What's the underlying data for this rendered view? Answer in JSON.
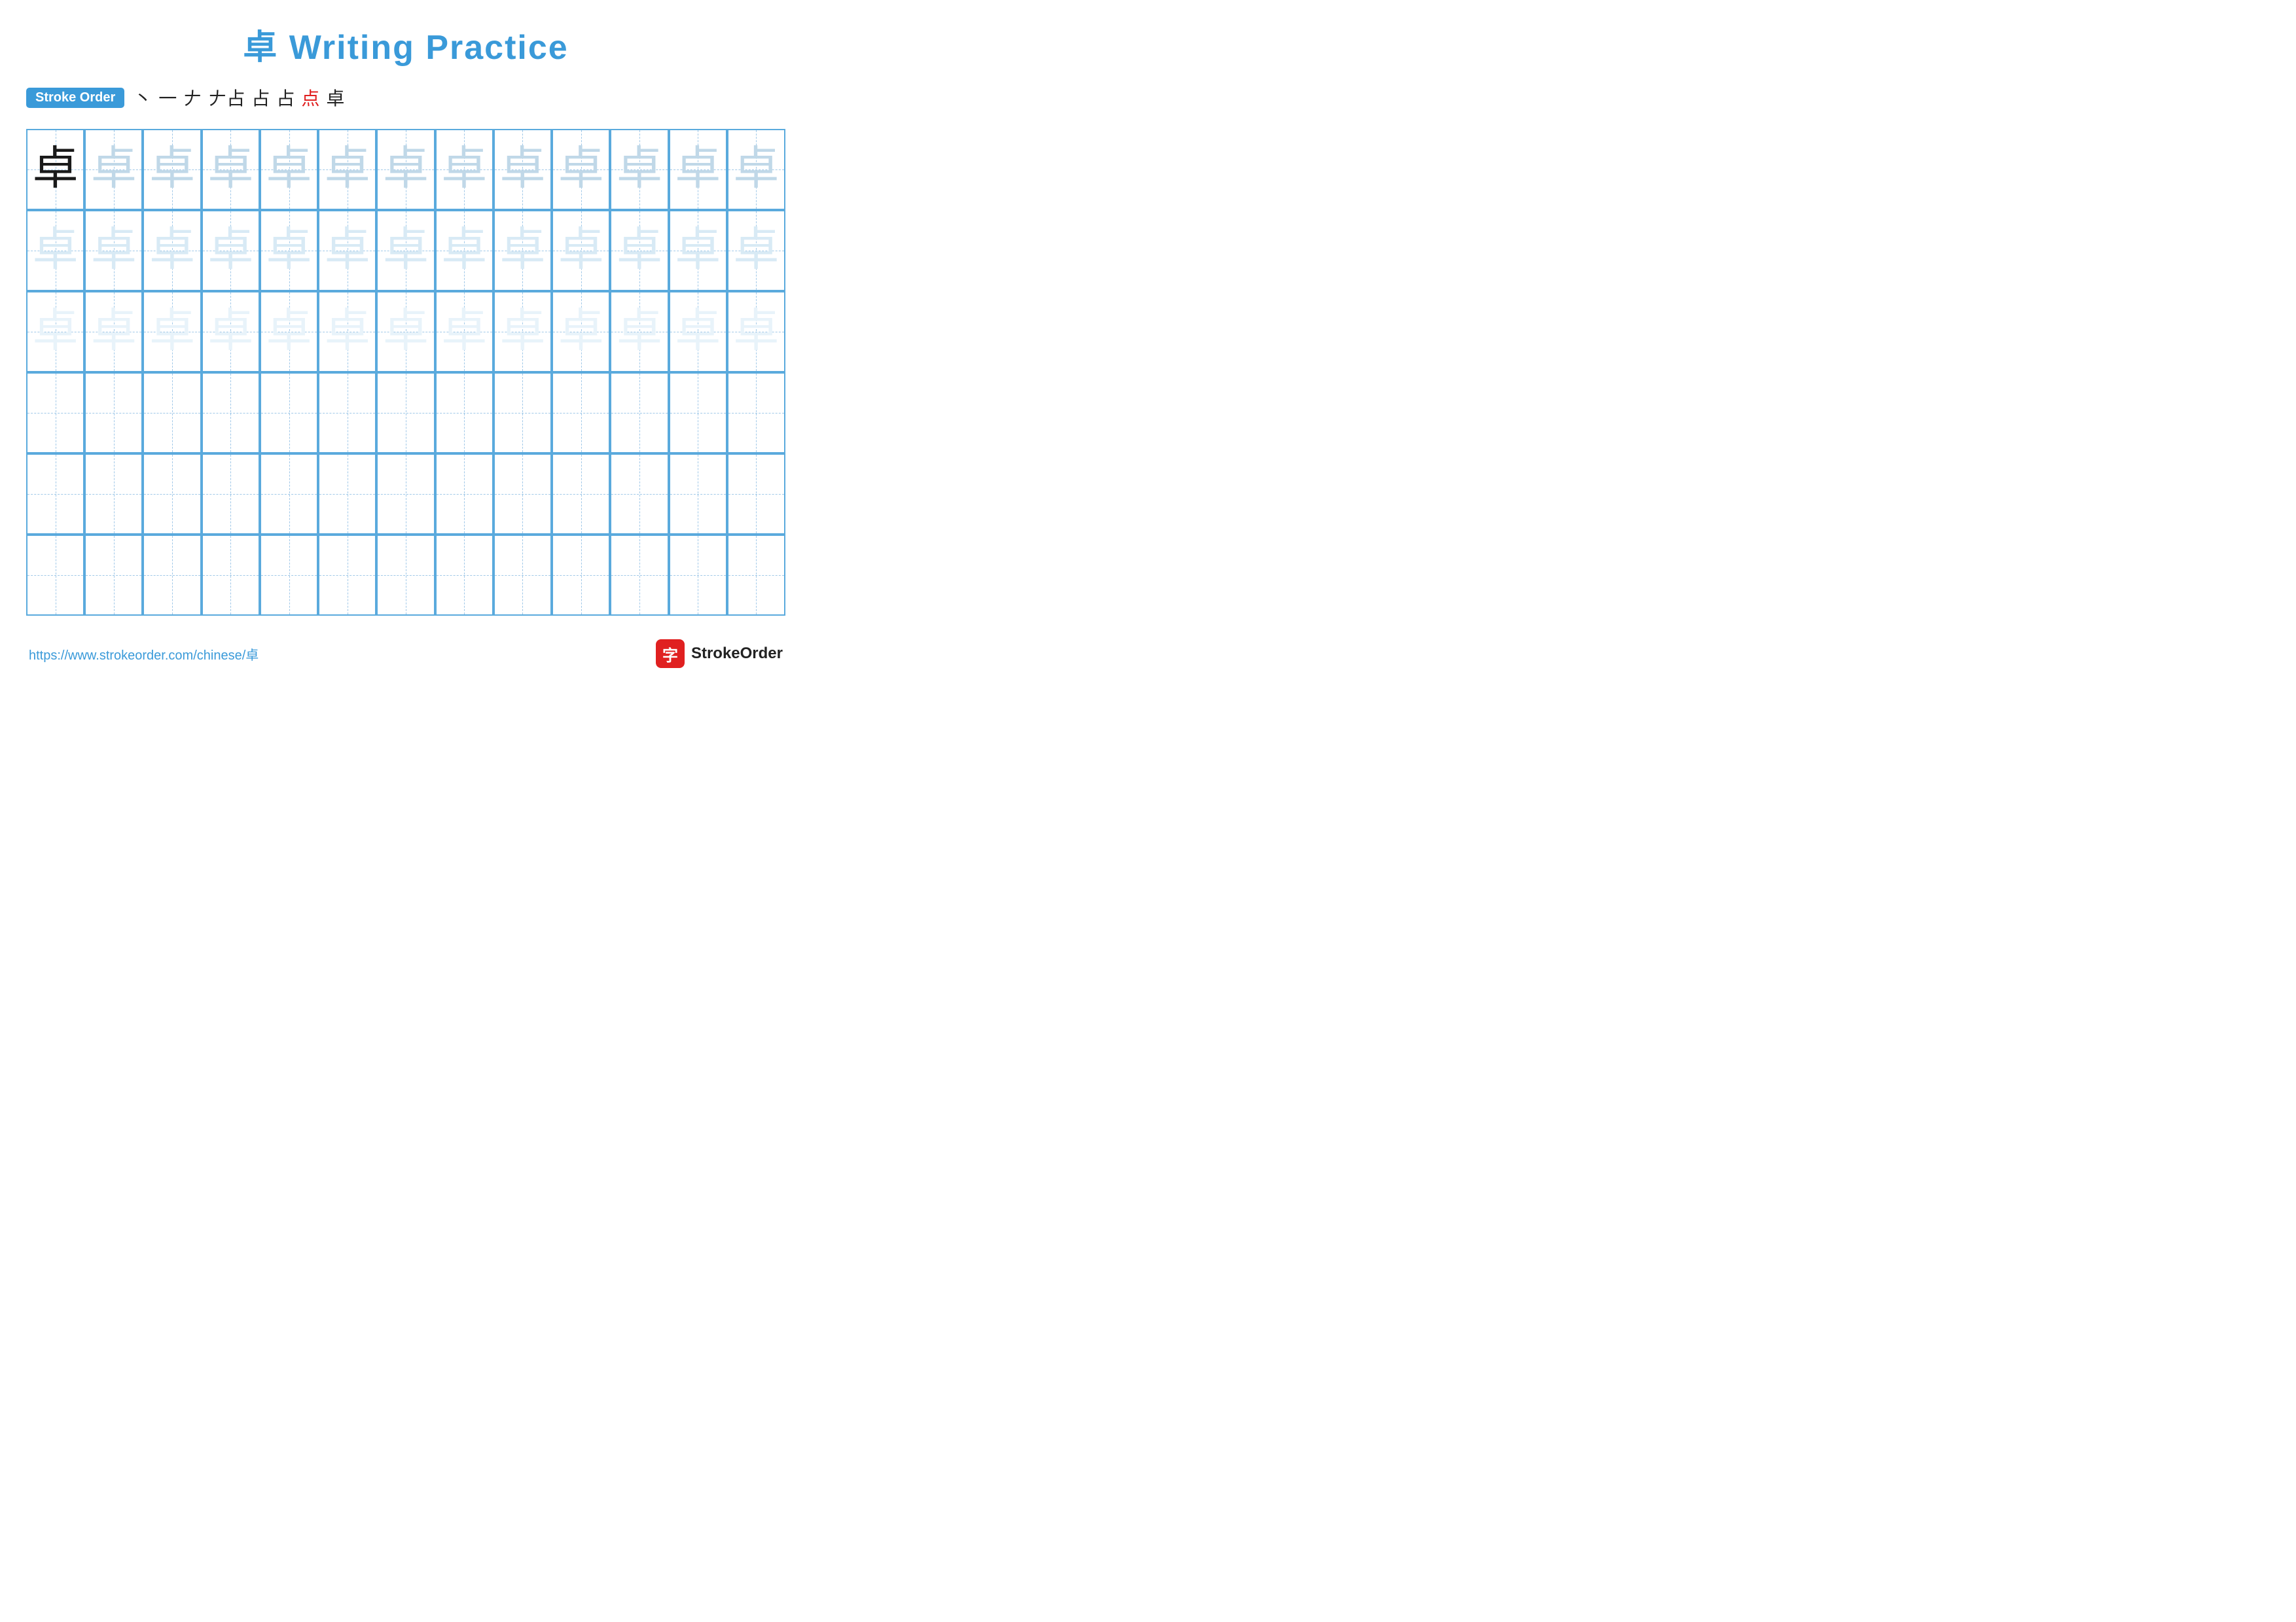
{
  "title": {
    "char": "卓",
    "rest": " Writing Practice",
    "color": "#3a9ad9"
  },
  "stroke_order": {
    "badge_label": "Stroke Order",
    "strokes": [
      "丶",
      "一",
      "丨",
      "丆",
      "占",
      "占",
      "点",
      "卓"
    ],
    "last_stroke_red": true
  },
  "character": "卓",
  "grid": {
    "rows": 6,
    "cols": 13,
    "row_types": [
      "row1",
      "row2",
      "row3",
      "row4",
      "row5",
      "row6"
    ]
  },
  "footer": {
    "url": "https://www.strokeorder.com/chinese/卓",
    "logo_char": "字",
    "logo_text": "StrokeOrder"
  }
}
